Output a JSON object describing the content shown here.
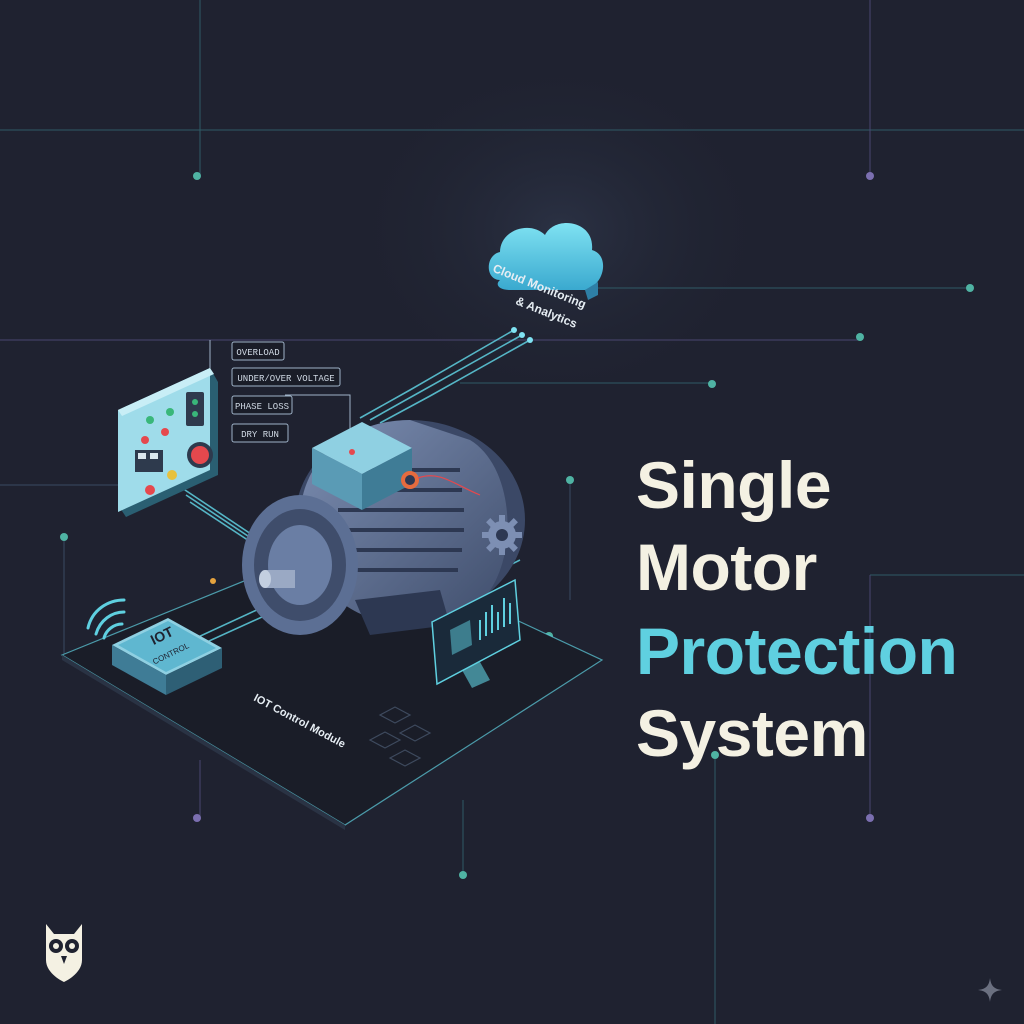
{
  "title": {
    "line1": "Single",
    "line2": "Motor",
    "line3": "Protection",
    "line4": "System"
  },
  "labels": {
    "cloud_line1": "Cloud Monitoring",
    "cloud_line2": "& Analytics",
    "iot_module": "IOT Control Module",
    "iot_device_line1": "IOT",
    "iot_device_line2": "CONTROL"
  },
  "faults": [
    "OVERLOAD",
    "UNDER/OVER VOLTAGE",
    "PHASE LOSS",
    "DRY RUN"
  ],
  "colors": {
    "background": "#1f2230",
    "accent": "#5fd0e0",
    "title": "#f4f1e3",
    "motor": "#5c6f94",
    "panel": "#9fdcea"
  },
  "icons": [
    "owl-logo-icon",
    "sparkle-icon",
    "gear-icon",
    "wifi-icon",
    "cloud-icon"
  ]
}
